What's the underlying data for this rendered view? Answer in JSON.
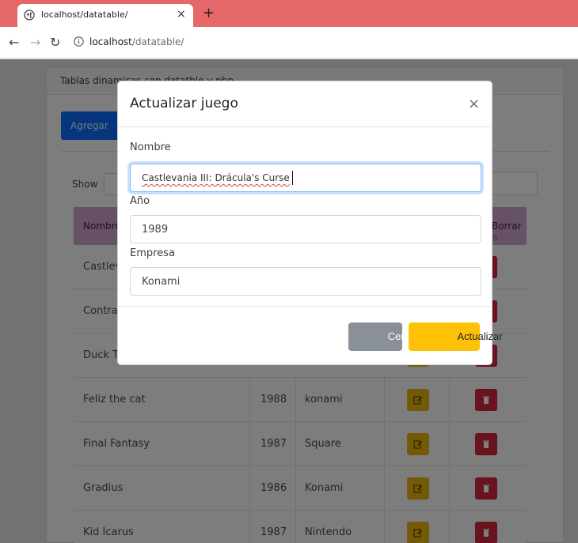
{
  "browser": {
    "tab_title": "localhost/datatable/",
    "tab_close": "×",
    "new_tab": "+",
    "url_host": "localhost",
    "url_path": "/datatable/"
  },
  "page": {
    "card_header": "Tablas dinamicas con datatble y php",
    "add_button": "Agregar",
    "show_label": "Show",
    "columns": [
      "Nombre",
      "Borrar"
    ],
    "rows": [
      {
        "nombre": "Castlevania III: Drácula's Curse",
        "anio": "",
        "empresa": ""
      },
      {
        "nombre": "Contra",
        "anio": "",
        "empresa": ""
      },
      {
        "nombre": "Duck Tales",
        "anio": "",
        "empresa": ""
      },
      {
        "nombre": "Feliz the cat",
        "anio": "1988",
        "empresa": "konami"
      },
      {
        "nombre": "Final Fantasy",
        "anio": "1987",
        "empresa": "Square"
      },
      {
        "nombre": "Gradius",
        "anio": "1986",
        "empresa": "Konami"
      },
      {
        "nombre": "Kid Icarus",
        "anio": "1987",
        "empresa": "Nintendo"
      }
    ]
  },
  "modal": {
    "title": "Actualizar juego",
    "close": "×",
    "nombre_label": "Nombre",
    "nombre_value": "Castlevania III: Drácula's Curse",
    "anio_label": "Año",
    "anio_value": "1989",
    "empresa_label": "Empresa",
    "empresa_value": "Konami",
    "cerrar_button": "Cerrar",
    "actualizar_button": "Actualizar"
  },
  "colors": {
    "tabbar": "#e56868",
    "primary": "#0d6efd",
    "warning": "#ffc107",
    "secondary": "#8a9097",
    "danger": "#d0293d",
    "table_header": "#cfa2cf"
  },
  "icons": [
    "globe-icon",
    "back-arrow-icon",
    "forward-arrow-icon",
    "reload-icon",
    "info-icon",
    "close-icon",
    "edit-icon",
    "trash-icon"
  ]
}
